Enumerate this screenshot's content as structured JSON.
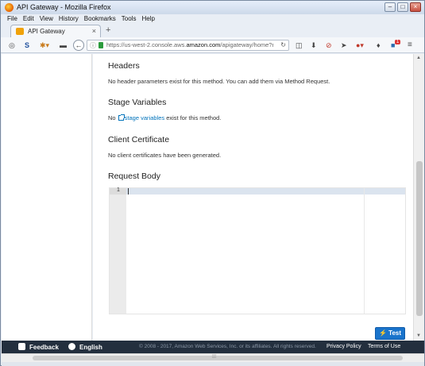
{
  "window": {
    "title": "API Gateway - Mozilla Firefox",
    "buttons": {
      "minimize": "–",
      "maximize": "□",
      "close": "×"
    }
  },
  "menu": [
    "File",
    "Edit",
    "View",
    "History",
    "Bookmarks",
    "Tools",
    "Help"
  ],
  "tab": {
    "label": "API Gateway",
    "close": "×",
    "new_tab": "+"
  },
  "nav": {
    "url_prefix": "https://us-west-2.console.aws.",
    "url_domain": "amazon.com",
    "url_suffix": "/apigateway/home?r",
    "reload": "↻",
    "notification_count": "1"
  },
  "sections": {
    "headers": {
      "title": "Headers",
      "text": "No header parameters exist for this method. You can add them via Method Request."
    },
    "stage_variables": {
      "title": "Stage Variables",
      "prefix": "No ",
      "link": "stage variables",
      "suffix": " exist for this method."
    },
    "client_certificate": {
      "title": "Client Certificate",
      "text": "No client certificates have been generated."
    },
    "request_body": {
      "title": "Request Body",
      "line_number": "1"
    }
  },
  "test_button": {
    "label": "Test",
    "icon": "lightning-icon"
  },
  "footer": {
    "feedback": "Feedback",
    "language": "English",
    "copyright": "© 2008 - 2017, Amazon Web Services, Inc. or its affiliates. All rights reserved.",
    "privacy": "Privacy Policy",
    "terms": "Terms of Use",
    "bg_color": "#232f3e"
  },
  "accent_color": "#1a74cc"
}
